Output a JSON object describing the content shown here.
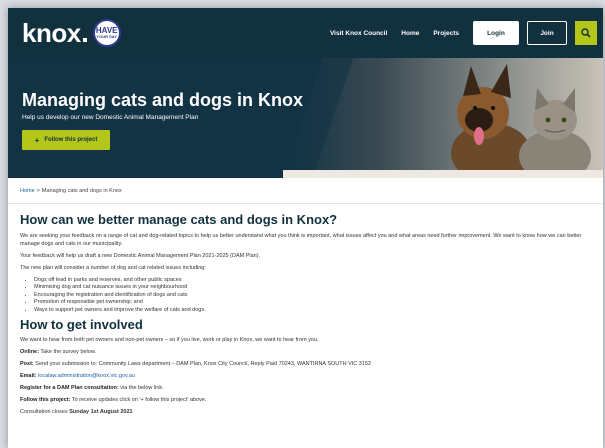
{
  "nav": {
    "logo_text": "knox",
    "badge_line1": "HAVE",
    "badge_line2": "YOUR SAY",
    "links": [
      "Visit Knox Council",
      "Home",
      "Projects"
    ],
    "login_label": "Login",
    "join_label": "Join",
    "search_icon": "search-icon",
    "colors": {
      "bar": "#11313f",
      "accent": "#b5c61b"
    }
  },
  "hero": {
    "title": "Managing cats and dogs in Knox",
    "subtitle": "Help us develop our new Domestic Animal Management Plan",
    "follow_label": "Follow this project"
  },
  "breadcrumb": {
    "home": "Home",
    "separator": ">",
    "current": "Managing cats and dogs in Knox"
  },
  "content": {
    "heading1": "How can we better manage cats and dogs in Knox?",
    "intro_paragraph": "We are seeking your feedback on a range of cat and dog-related topics to help us better understand what you think is important, what issues affect you and what areas need further improvement. We want to know how we can better manage dogs and cats in our municipality.",
    "feedback_paragraph": "Your feedback will help us draft a new Domestic Animal Management Plan 2021-2025 (DAM Plan).",
    "issues_intro": "The new plan will consider a number of dog and cat related issues including:",
    "issues": [
      "Dogs off lead in parks and reserves, and other public spaces",
      "Minimising dog and cat nuisance issues in your neighbourhood",
      "Encouraging the registration and identification of dogs and cats",
      "Promotion of responsible pet ownership; and",
      "Ways to support pet owners and improve the welfare of cats and dogs."
    ],
    "heading2": "How to get involved",
    "involved_paragraph": "We want to hear from both pet owners and non-pet owners – so if you live, work or play in Knox, we want to hear from you.",
    "online_label": "Online:",
    "online_text": "Take the survey below.",
    "post_label": "Post:",
    "post_text": "Send your submission to: Community Laws department – DAM Plan, Knox City Council, Reply Paid 70243, WANTIRNA SOUTH VIC 3152",
    "email_label": "Email:",
    "email_text": "localaw.administration@knox.vic.gov.au",
    "register_label": "Register for a DAM Plan consultation:",
    "register_text": "via the below link.",
    "follow_label": "Follow this project:",
    "follow_text": "To receive updates click on '+ follow this project' above.",
    "closes_text": "Consultation closes",
    "closes_date": "Sunday 1st August 2021"
  }
}
